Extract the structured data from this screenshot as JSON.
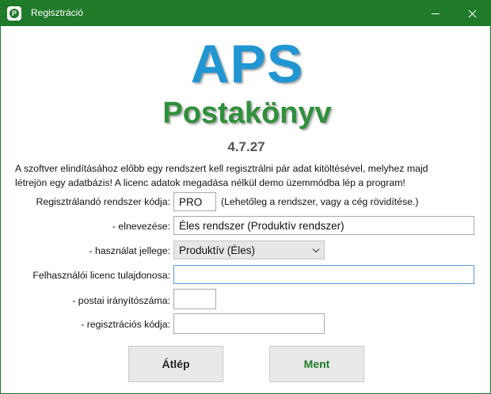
{
  "window": {
    "title": "Regisztráció",
    "icon": "app-p-icon",
    "accent": "#1f7a2a"
  },
  "logo": {
    "aps": "APS",
    "postakonyv": "Postakönyv",
    "aps_color": "#2196d3",
    "postakonyv_color": "#2f8f3a"
  },
  "version": "4.7.27",
  "intro": {
    "line1": "A szoftver elindításához előbb egy rendszert kell regisztrálni pár adat kitöltésével, melyhez majd",
    "line2": "létrejön egy adatbázis! A licenc adatok megadása nélkül demo üzemmódba lép a program!"
  },
  "form": {
    "code_label": "Regisztrálandó rendszer kódja:",
    "code_value": "PRO",
    "code_hint": "(Lehetőleg a rendszer, vagy a cég rövidítése.)",
    "name_label": "- elnevezése:",
    "name_value": "Éles rendszer (Produktív rendszer)",
    "usage_label": "- használat jellege:",
    "usage_value": "Produktív (Éles)",
    "owner_label": "Felhasználói licenc tulajdonosa:",
    "owner_value": "",
    "zip_label": "- postai irányítószáma:",
    "zip_value": "",
    "regcode_label": "- regisztrációs kódja:",
    "regcode_value": ""
  },
  "buttons": {
    "skip": "Átlép",
    "save": "Ment"
  }
}
